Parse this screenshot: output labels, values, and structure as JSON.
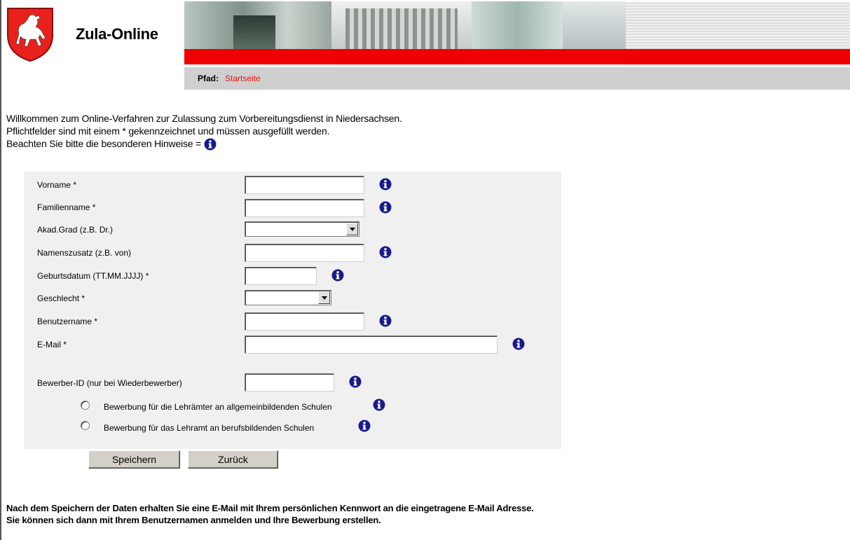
{
  "header": {
    "app_title": "Zula-Online",
    "path_label": "Pfad:",
    "path_link": "Startseite"
  },
  "intro": {
    "line1": "Willkommen zum Online-Verfahren zur Zulassung zum Vorbereitungsdienst in Niedersachsen.",
    "line2": "Pflichtfelder sind mit einem * gekennzeichnet und müssen ausgefüllt werden.",
    "line3": "Beachten Sie bitte die besonderen Hinweise ="
  },
  "form": {
    "vorname_label": "Vorname *",
    "vorname_value": "",
    "familienname_label": "Familienname *",
    "familienname_value": "",
    "akad_grad_label": "Akad.Grad (z.B. Dr.)",
    "akad_grad_value": "",
    "namenszusatz_label": "Namenszusatz (z.B. von)",
    "namenszusatz_value": "",
    "geburtsdatum_label": "Geburtsdatum (TT.MM.JJJJ) *",
    "geburtsdatum_value": "",
    "geschlecht_label": "Geschlecht *",
    "geschlecht_value": "",
    "benutzername_label": "Benutzername *",
    "benutzername_value": "",
    "email_label": "E-Mail *",
    "email_value": "",
    "bewerber_id_label": "Bewerber-ID (nur bei Wiederbewerber)",
    "bewerber_id_value": "",
    "radio1_label": "Bewerbung für die Lehrämter an allgemeinbildenden Schulen",
    "radio2_label": "Bewerbung für das Lehramt an berufsbildenden Schulen"
  },
  "buttons": {
    "save": "Speichern",
    "back": "Zurück"
  },
  "footer": {
    "line1": "Nach dem Speichern der Daten erhalten Sie eine E-Mail mit Ihrem persönlichen Kennwort an die eingetragene E-Mail Adresse.",
    "line2": "Sie können sich dann mit Ihrem Benutzernamen anmelden und Ihre Bewerbung erstellen."
  },
  "colors": {
    "accent_red": "#ee0000",
    "path_bar": "#cfcfcf",
    "form_panel": "#f0f0f0",
    "info_icon": "#1a1a8c"
  },
  "icons": [
    "coat-of-arms-icon",
    "info-icon",
    "radio-icon"
  ]
}
